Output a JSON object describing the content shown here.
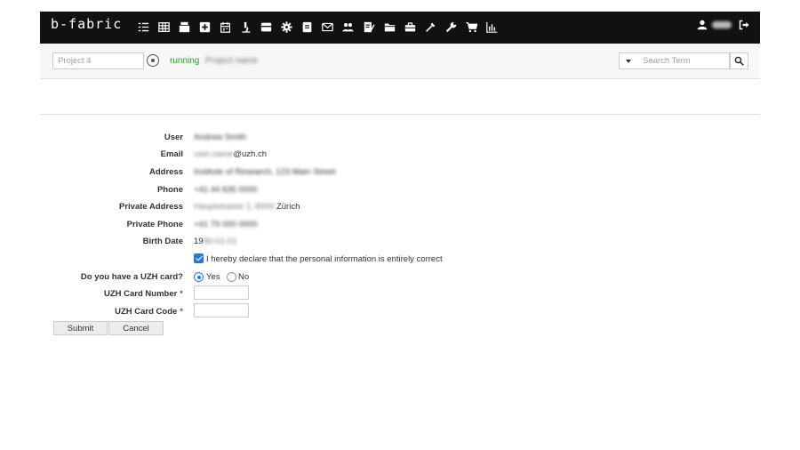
{
  "navbar": {
    "logo": "b-fabric",
    "icons": [
      "list-check-icon",
      "table-icon",
      "inbox-stack-icon",
      "plus-box-icon",
      "calendar-icon",
      "microscope-icon",
      "drawer-icon",
      "gear-icon",
      "document-icon",
      "envelope-icon",
      "users-icon",
      "edit-document-icon",
      "folder-icon",
      "briefcase-icon",
      "pipette-icon",
      "wrench-icon",
      "cart-icon",
      "bar-chart-icon"
    ],
    "user_icon": "user-icon",
    "user_name": "user",
    "logout_icon": "logout-icon"
  },
  "toolbar": {
    "project_placeholder": "Project 4",
    "status": "running",
    "project_name": "Project name",
    "search_placeholder": "Search Term"
  },
  "form": {
    "user_label": "User",
    "user_value": "Andrew Smith",
    "email_label": "Email",
    "email_value_blurred": "user.name",
    "email_value_domain": "@uzh.ch",
    "address_label": "Address",
    "address_value": "Institute of Research, 123 Main Street",
    "phone_label": "Phone",
    "phone_value": "+41 44 635 0000",
    "private_address_label": "Private Address",
    "private_address_value_blurred": "Hauptstrasse 1, 8000",
    "private_address_value_tail": "Zürich",
    "private_phone_label": "Private Phone",
    "private_phone_value": "+41 79 000 0000",
    "birth_date_label": "Birth Date",
    "birth_date_value": "19",
    "birth_date_value_blurred": "80-01-01",
    "declare_text": "I hereby declare that the personal information is entirely correct",
    "uzh_card_question": "Do you have a UZH card?",
    "yes_label": "Yes",
    "no_label": "No",
    "card_number_label": "UZH Card Number",
    "card_code_label": "UZH Card Code",
    "required_mark": "*"
  },
  "actions": {
    "submit": "Submit",
    "cancel": "Cancel"
  },
  "colors": {
    "navbar_bg": "#111111",
    "running": "#2d9d2d",
    "accent": "#2a77d6",
    "required": "#c0392b"
  }
}
